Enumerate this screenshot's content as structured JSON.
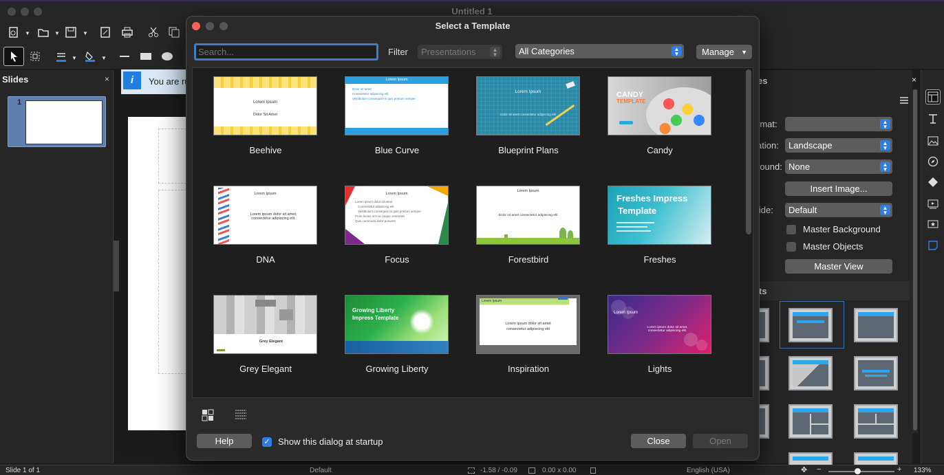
{
  "window": {
    "title": "Untitled 1"
  },
  "slides_pane": {
    "title": "Slides",
    "close": "×",
    "slide_number": "1"
  },
  "info_bar": {
    "text": "You are ru",
    "icon": "i"
  },
  "sidebar": {
    "labels": {
      "format": "rmat:",
      "orientation": "ation:",
      "background": "round:",
      "master_slide": "lide:"
    },
    "format_value": "",
    "orientation_value": "Landscape",
    "background_value": "None",
    "insert_image": "Insert Image...",
    "master_slide_value": "Default",
    "master_background": "Master Background",
    "master_objects": "Master Objects",
    "master_view": "Master View",
    "layouts_section": "ts",
    "panel_title": "es",
    "close": "×"
  },
  "status": {
    "slide": "Slide 1 of 1",
    "master": "Default",
    "position": "-1.58 / -0.09",
    "size": "0.00 x 0.00",
    "language": "English (USA)",
    "zoom": "133%",
    "zoom_fraction": 0.44
  },
  "dialog": {
    "title": "Select a Template",
    "search_placeholder": "Search...",
    "filter_label": "Filter",
    "filter_value": "Presentations",
    "category_value": "All Categories",
    "manage_label": "Manage",
    "help_label": "Help",
    "show_at_startup_label": "Show this dialog at startup",
    "show_at_startup_checked": true,
    "close_label": "Close",
    "open_label": "Open",
    "templates": [
      {
        "name": "Beehive",
        "lines": [
          "Lorem Ipsum",
          "Dolor Sit Amet"
        ]
      },
      {
        "name": "Blue Curve",
        "lines": [
          "Lorem Ipsum",
          "Dolor sit amet",
          "Consectetur adipiscing elit",
          "Vestibulum consequat mi quis pretium semper"
        ]
      },
      {
        "name": "Blueprint Plans",
        "lines": [
          "Lorem Ipsum",
          "Dolor sit amet consectetur adipiscing elit"
        ]
      },
      {
        "name": "Candy",
        "lines": [
          "CANDY",
          "TEMPLATE"
        ]
      },
      {
        "name": "DNA",
        "lines": [
          "Lorem Ipsum",
          "Lorem ipsum dolor sit amet, consectetur adipiscing elit."
        ]
      },
      {
        "name": "Focus",
        "lines": [
          "Lorem Ipsum",
          "Lorem ipsum dolor sit amet",
          "Consectetur adipiscing elit",
          "Vestibulum consequat mi quis pretium semper",
          "Proin luctus orci ac neque venenatis",
          "Quis commodo dolor posuere"
        ]
      },
      {
        "name": "Forestbird",
        "lines": [
          "Lorem Ipsum",
          "Dolor sit amet consectetur adipiscing elit"
        ]
      },
      {
        "name": "Freshes",
        "lines": [
          "Freshes Impress",
          "Template"
        ]
      },
      {
        "name": "Grey Elegant",
        "lines": [
          "Grey Elegant"
        ]
      },
      {
        "name": "Growing Liberty",
        "lines": [
          "Growing Liberty",
          "Impress Template"
        ]
      },
      {
        "name": "Inspiration",
        "lines": [
          "Lorem Ipsum",
          "Lorem ipsum dolor sit amet",
          "consectetur adipiscing elit"
        ]
      },
      {
        "name": "Lights",
        "lines": [
          "Lorem Ipsum",
          "Lorem ipsum dolor sit amet, consectetur adipiscing elit."
        ]
      }
    ]
  },
  "colors": {
    "accent": "#2f7de1",
    "search_focus": "#3f7fc6",
    "close_dot": "#ff5f57"
  }
}
